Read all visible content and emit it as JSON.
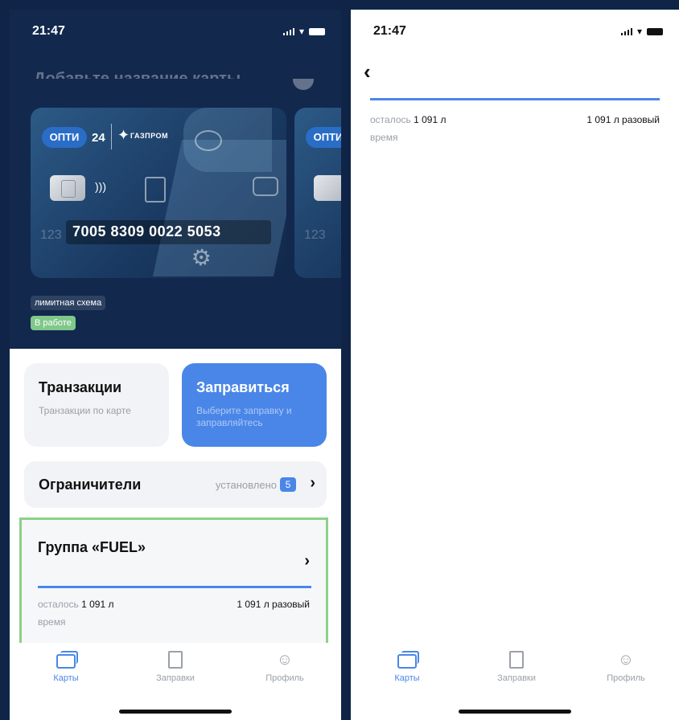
{
  "left_screen": {
    "status_bar": {
      "time": "21:47"
    },
    "faded_header": "Добавьте название карты",
    "card": {
      "brand": "ОПТИ",
      "brand_num": "24",
      "partner": "ГАЗПРОМ",
      "ghost_digits": "123",
      "number": "7005 8309 0022 5053"
    },
    "next_card": {
      "brand": "ОПТИ",
      "ghost_digits": "123"
    },
    "tags": {
      "scheme": "лимитная схема",
      "status": "В работе"
    },
    "tiles": {
      "transactions": {
        "title": "Транзакции",
        "subtitle": "Транзакции по карте"
      },
      "refuel": {
        "title": "Заправиться",
        "subtitle": "Выберите заправку и заправляйтесь"
      }
    },
    "limits_row": {
      "label": "Ограничители",
      "installed": "установлено",
      "count": "5"
    },
    "group": {
      "title": "Группа «FUEL»",
      "remaining_label": "осталось",
      "remaining_value": "1 091 л",
      "limit": "1 091 л разовый",
      "time_label": "время",
      "progress_pct": 100
    }
  },
  "right_screen": {
    "status_bar": {
      "time": "21:47"
    },
    "detail": {
      "remaining_label": "осталось",
      "remaining_value": "1 091 л",
      "limit": "1 091 л разовый",
      "time_label": "время",
      "progress_pct": 100
    }
  },
  "tabbar": {
    "items": [
      {
        "label": "Карты",
        "icon": "cards-icon",
        "active": true
      },
      {
        "label": "Заправки",
        "icon": "fuel-station-icon",
        "active": false
      },
      {
        "label": "Профиль",
        "icon": "profile-icon",
        "active": false
      }
    ]
  },
  "colors": {
    "accent": "#4a86e8",
    "dark_bg": "#12284d",
    "status_green": "#7fc88a",
    "highlight_border": "#8bd187"
  }
}
